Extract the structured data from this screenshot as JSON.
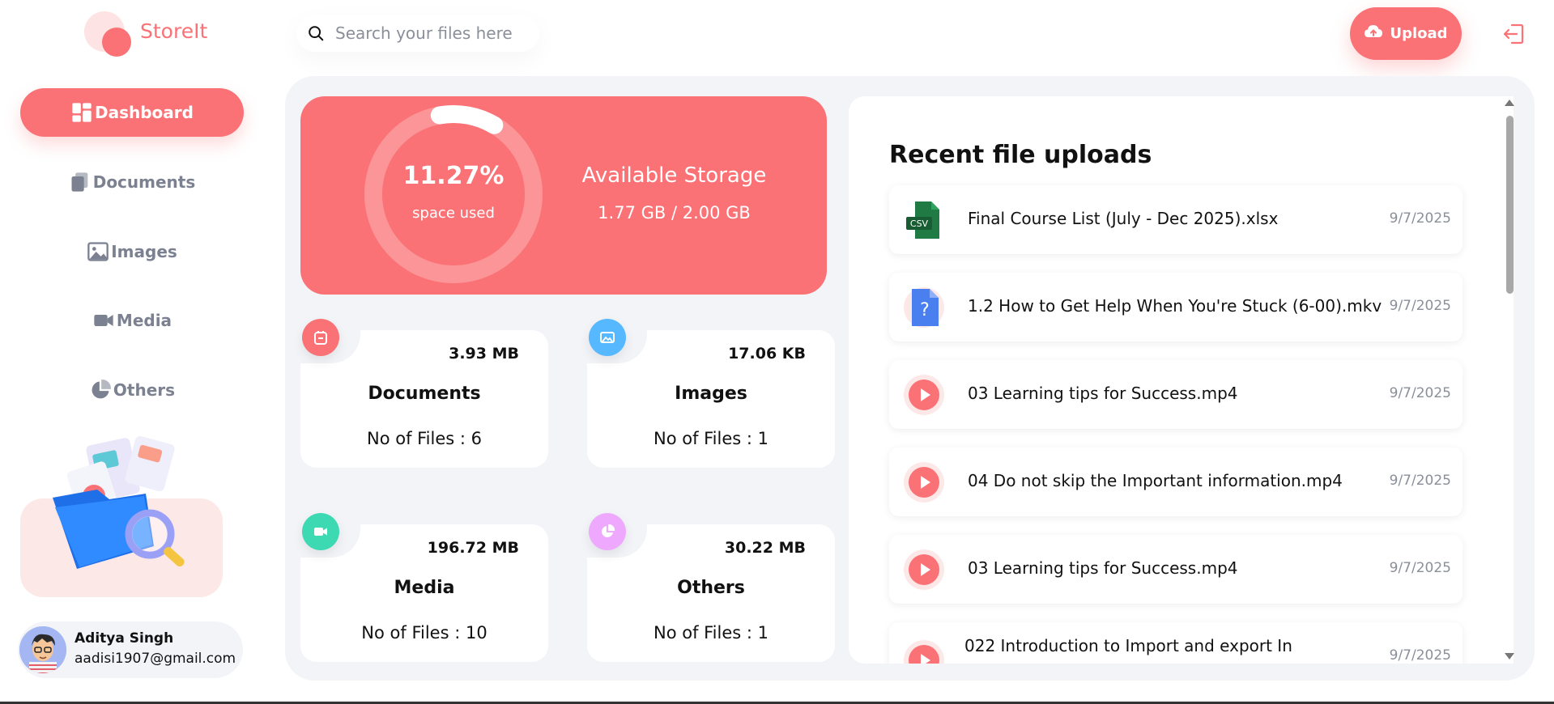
{
  "app": {
    "name": "StoreIt"
  },
  "sidebar": {
    "items": [
      {
        "label": "Dashboard",
        "icon": "dashboard-icon",
        "active": true
      },
      {
        "label": "Documents",
        "icon": "documents-icon"
      },
      {
        "label": "Images",
        "icon": "images-icon"
      },
      {
        "label": "Media",
        "icon": "video-icon"
      },
      {
        "label": "Others",
        "icon": "pie-chart-icon"
      }
    ],
    "user": {
      "name": "Aditya Singh",
      "email": "aadisi1907@gmail.com"
    }
  },
  "header": {
    "search_placeholder": "Search your files here",
    "upload_label": "Upload"
  },
  "storage": {
    "percent_label": "11.27%",
    "percent_value": 0.1127,
    "percent_sub": "space used",
    "title": "Available Storage",
    "value": "1.77 GB / 2.00 GB"
  },
  "categories": [
    {
      "name": "Documents",
      "size": "3.93 MB",
      "count": "No of Files : 6",
      "color": "#fa7275"
    },
    {
      "name": "Images",
      "size": "17.06 KB",
      "count": "No of Files : 1",
      "color": "#56b8ff"
    },
    {
      "name": "Media",
      "size": "196.72 MB",
      "count": "No of Files : 10",
      "color": "#3dd9b3"
    },
    {
      "name": "Others",
      "size": "30.22 MB",
      "count": "No of Files : 1",
      "color": "#eea8fd"
    }
  ],
  "recent": {
    "title": "Recent file uploads",
    "files": [
      {
        "name": "Final Course List (July - Dec 2025).xlsx",
        "date": "9/7/2025",
        "type": "csv"
      },
      {
        "name": "1.2 How to Get Help When You're Stuck (6-00).mkv",
        "date": "9/7/2025",
        "type": "unknown"
      },
      {
        "name": "03 Learning tips for Success.mp4",
        "date": "9/7/2025",
        "type": "video"
      },
      {
        "name": "04 Do not skip the Important information.mp4",
        "date": "9/7/2025",
        "type": "video"
      },
      {
        "name": "03 Learning tips for Success.mp4",
        "date": "9/7/2025",
        "type": "video"
      },
      {
        "name": "022 Introduction to Import and export In",
        "date": "9/7/2025",
        "type": "video"
      }
    ]
  },
  "colors": {
    "brand": "#fa7275",
    "background": "#f2f4f8"
  }
}
